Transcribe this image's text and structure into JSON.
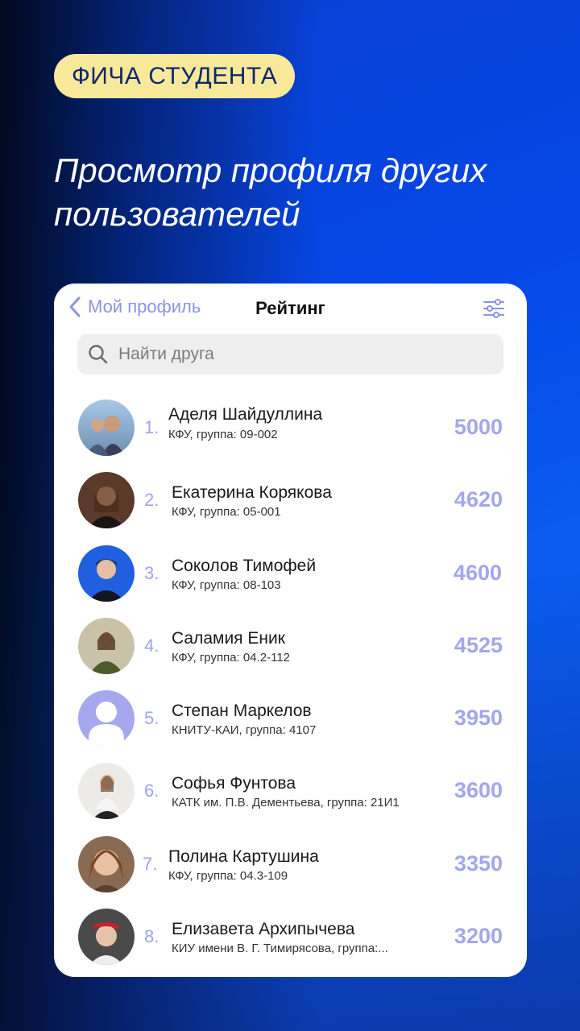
{
  "badge": "ФИЧА СТУДЕНТА",
  "headline": "Просмотр профиля других пользователей",
  "nav": {
    "back_label": "Мой профиль",
    "title": "Рейтинг"
  },
  "search": {
    "placeholder": "Найти друга"
  },
  "users": [
    {
      "rank": "1.",
      "name": "Аделя Шайдуллина",
      "info": "КФУ, группа: 09-002",
      "score": "5000"
    },
    {
      "rank": "2.",
      "name": "Екатерина Корякова",
      "info": "КФУ, группа: 05-001",
      "score": "4620"
    },
    {
      "rank": "3.",
      "name": "Соколов Тимофей",
      "info": "КФУ, группа: 08-103",
      "score": "4600"
    },
    {
      "rank": "4.",
      "name": "Саламия Еник",
      "info": "КФУ, группа: 04.2-112",
      "score": "4525"
    },
    {
      "rank": "5.",
      "name": "Степан Маркелов",
      "info": "КНИТУ-КАИ, группа: 4107",
      "score": "3950"
    },
    {
      "rank": "6.",
      "name": "Софья Фунтова",
      "info": "КАТК им. П.В. Дементьева, группа: 21И1",
      "score": "3600"
    },
    {
      "rank": "7.",
      "name": "Полина Картушина",
      "info": "КФУ, группа: 04.3-109",
      "score": "3350"
    },
    {
      "rank": "8.",
      "name": "Елизавета Архипычева",
      "info": "КИУ имени В. Г. Тимирясова, группа:...",
      "score": "3200"
    }
  ],
  "colors": {
    "accent": "#8c93e0",
    "badge_bg": "#f8e99a",
    "background": "#0547e6"
  }
}
